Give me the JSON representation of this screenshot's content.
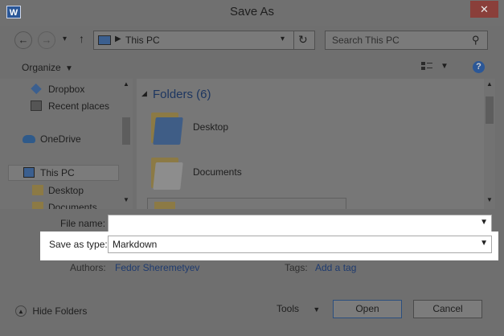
{
  "window": {
    "title": "Save As",
    "app_icon": "W"
  },
  "nav": {
    "back": "←",
    "forward": "→",
    "up": "↑",
    "breadcrumb": "This PC",
    "search_placeholder": "Search This PC"
  },
  "toolbar": {
    "organize": "Organize"
  },
  "sidebar": {
    "items": [
      {
        "label": "Dropbox"
      },
      {
        "label": "Recent places"
      },
      {
        "label": "OneDrive"
      },
      {
        "label": "This PC"
      },
      {
        "label": "Desktop"
      },
      {
        "label": "Documents"
      }
    ]
  },
  "content": {
    "group_header": "Folders (6)",
    "folders": [
      {
        "label": "Desktop"
      },
      {
        "label": "Documents"
      }
    ]
  },
  "form": {
    "file_name_label": "File name:",
    "file_name_value": "",
    "save_type_label": "Save as type:",
    "save_type_value": "Markdown",
    "authors_label": "Authors:",
    "authors_value": "Fedor Sheremetyev",
    "tags_label": "Tags:",
    "tags_value": "Add a tag"
  },
  "footer": {
    "hide_folders": "Hide Folders",
    "tools": "Tools",
    "open": "Open",
    "cancel": "Cancel"
  },
  "colors": {
    "accent": "#2b5797",
    "link": "#1f3b6f",
    "highlight": "#ffffff"
  }
}
